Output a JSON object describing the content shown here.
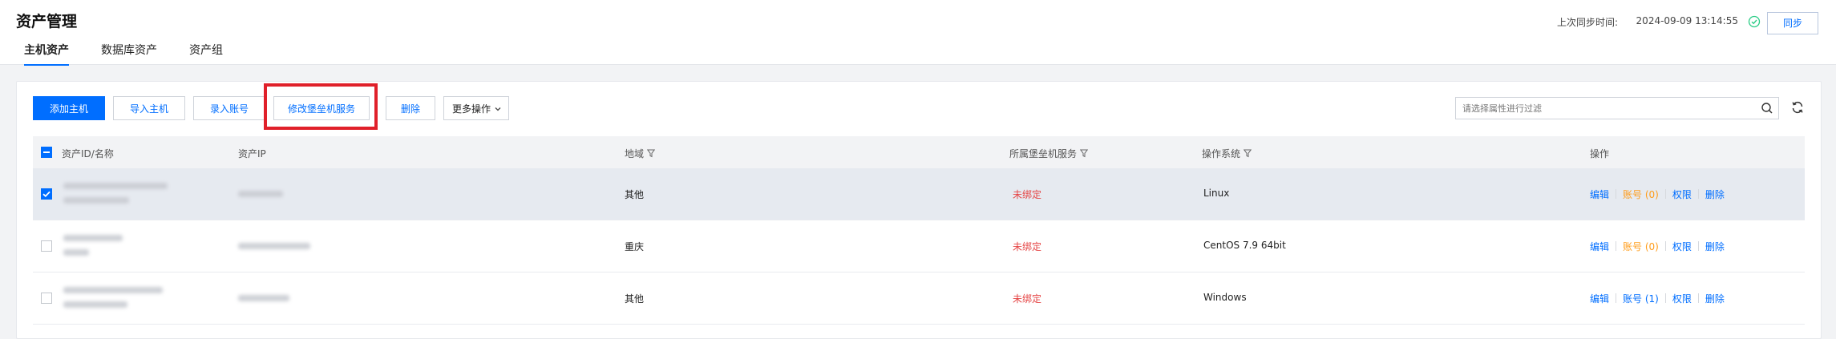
{
  "header": {
    "title": "资产管理",
    "tabs": [
      {
        "label": "主机资产",
        "active": true
      },
      {
        "label": "数据库资产",
        "active": false
      },
      {
        "label": "资产组",
        "active": false
      }
    ],
    "sync_label": "上次同步时间:",
    "sync_time": "2024-09-09 13:14:55",
    "sync_button": "同步"
  },
  "toolbar": {
    "add_host": "添加主机",
    "import_host": "导入主机",
    "enter_account": "录入账号",
    "modify_service": "修改堡垒机服务",
    "delete": "删除",
    "more_ops": "更多操作",
    "search_placeholder": "请选择属性进行过滤"
  },
  "table": {
    "columns": {
      "asset": "资产ID/名称",
      "ip": "资产IP",
      "region": "地域",
      "service": "所属堡垒机服务",
      "os": "操作系统",
      "ops": "操作"
    },
    "rows": [
      {
        "selected": true,
        "region": "其他",
        "service": "未绑定",
        "os": "Linux",
        "ops": {
          "edit": "编辑",
          "account": "账号 (0)",
          "permission": "权限",
          "delete": "删除"
        }
      },
      {
        "selected": false,
        "region": "重庆",
        "service": "未绑定",
        "os": "CentOS 7.9 64bit",
        "ops": {
          "edit": "编辑",
          "account": "账号 (0)",
          "permission": "权限",
          "delete": "删除"
        }
      },
      {
        "selected": false,
        "region": "其他",
        "service": "未绑定",
        "os": "Windows",
        "ops": {
          "edit": "编辑",
          "account": "账号 (1)",
          "permission": "权限",
          "delete": "删除"
        }
      }
    ]
  },
  "colors": {
    "accent": "#006eff",
    "danger": "#e54545",
    "warning": "#ff9c19",
    "highlight": "#e0202a"
  }
}
